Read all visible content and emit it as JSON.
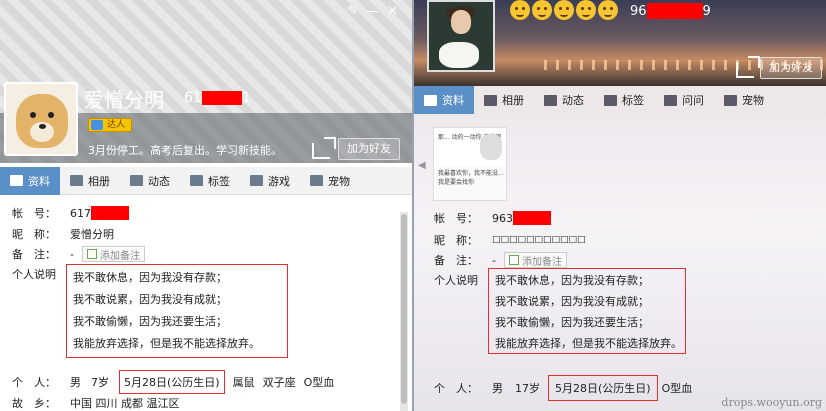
{
  "left": {
    "window_controls": [
      "✎",
      "—",
      "✕"
    ],
    "nickname": "爱憎分明",
    "qq_prefix": "61",
    "qq_suffix": "1",
    "badge": "达人",
    "signature": "3月份停工。高考后复出。学习新技能。",
    "add_friend": "加为好友",
    "tabs": [
      {
        "label": "资料",
        "icon": "profile-icon"
      },
      {
        "label": "相册",
        "icon": "album-icon"
      },
      {
        "label": "动态",
        "icon": "feed-icon"
      },
      {
        "label": "标签",
        "icon": "tag-icon"
      },
      {
        "label": "游戏",
        "icon": "game-icon"
      },
      {
        "label": "宠物",
        "icon": "pet-icon"
      }
    ],
    "fields": {
      "account_label": "帐　号：",
      "account_prefix": "617",
      "nick_label": "昵　称：",
      "nick_value": "爱憎分明",
      "note_label": "备　注：",
      "note_value": "-",
      "note_button": "添加备注",
      "desc_label": "个人说明"
    },
    "description": [
      "我不敢休息，因为我没有存款；",
      "我不敢说累，因为我没有成就；",
      "我不敢偷懒，因为我还要生活；",
      "我能放弃选择，但是我不能选择放弃。"
    ],
    "personal": {
      "label": "个　人：",
      "gender": "男",
      "age": "7岁",
      "birthday": "5月28日(公历生日)",
      "zodiac_cn": "属鼠",
      "zodiac": "双子座",
      "blood": "O型血"
    },
    "hometown": {
      "label": "故　乡：",
      "value": "中国 四川 成都 温江区"
    }
  },
  "right": {
    "qq_prefix": "96",
    "qq_suffix": "9",
    "add_friend": "加为好友",
    "tabs": [
      {
        "label": "资料",
        "icon": "profile-icon"
      },
      {
        "label": "相册",
        "icon": "album-icon"
      },
      {
        "label": "动态",
        "icon": "feed-icon"
      },
      {
        "label": "标签",
        "icon": "tag-icon"
      },
      {
        "label": "问问",
        "icon": "question-icon"
      },
      {
        "label": "宠物",
        "icon": "pet-icon"
      }
    ],
    "thumb1_text": "那... 动的一动你 还发挥",
    "thumb2_text": "我最喜欢你，我不能没... 我是要会找你",
    "fields": {
      "account_label": "帐　号：",
      "account_prefix": "963",
      "nick_label": "昵　称：",
      "nick_value": "□□□□□□□□□□□",
      "note_label": "备　注：",
      "note_value": "-",
      "note_button": "添加备注",
      "desc_label": "个人说明"
    },
    "description": [
      "我不敢休息，因为我没有存款；",
      "我不敢说累，因为我没有成就；",
      "我不敢偷懒，因为我还要生活；",
      "我能放弃选择，但是我不能选择放弃。"
    ],
    "personal": {
      "label": "个　人：",
      "gender": "男",
      "age": "17岁",
      "birthday": "5月28日(公历生日)",
      "blood": "O型血"
    }
  },
  "watermark": "drops.wooyun.org",
  "colors": {
    "accent": "#5b8fc7",
    "redact": "#ff0000",
    "highlight_box": "#e03030"
  }
}
